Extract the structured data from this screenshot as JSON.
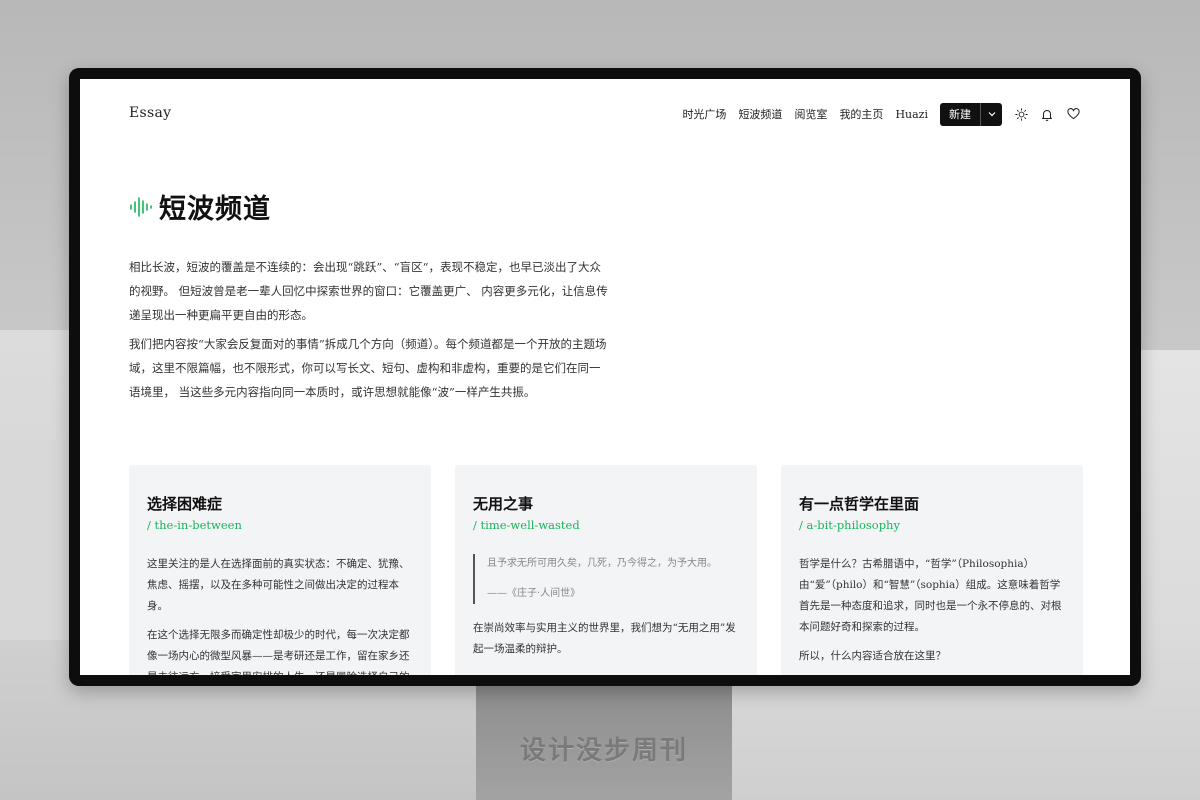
{
  "app": {
    "logo": "Essay",
    "nav": [
      "时光广场",
      "短波频道",
      "阅览室",
      "我的主页",
      "Huazi"
    ],
    "new_button": "新建",
    "icons": [
      "chevron-down-icon",
      "sun-icon",
      "bell-icon",
      "heart-icon"
    ]
  },
  "page": {
    "title": "短波频道",
    "title_icon": "sound-wave-icon",
    "accent_color": "#19b35a",
    "intro": [
      "相比长波，短波的覆盖是不连续的：会出现“跳跃”、“盲区“，表现不稳定，也早已淡出了大众的视野。 但短波曾是老一辈人回忆中探索世界的窗口：它覆盖更广、 内容更多元化，让信息传递呈现出一种更扁平更自由的形态。",
      "我们把内容按“大家会反复面对的事情”拆成几个方向（频道）。每个频道都是一个开放的主题场域，这里不限篇幅，也不限形式，你可以写长文、短句、虚构和非虚构，重要的是它们在同一语境里， 当这些多元内容指向同一本质时，或许思想就能像“波”一样产生共振。"
    ]
  },
  "cards": [
    {
      "title": "选择困难症",
      "slug": "/ the-in-between",
      "paragraphs": [
        "这里关注的是人在选择面前的真实状态：不确定、犹豫、焦虑、摇摆，以及在多种可能性之间做出决定的过程本身。",
        "在这个选择无限多而确定性却极少的时代，每一次决定都像一场内心的微型风暴——是考研还是工作，留在家乡还是去往远方，接受家里安排的人生，还是冒险选择自己的路。"
      ]
    },
    {
      "title": "无用之事",
      "slug": "/ time-well-wasted",
      "quote": "且予求无所可用久矣，几死，乃今得之，为予大用。",
      "quote_source": "——《庄子·人间世》",
      "paragraphs": [
        "在崇尚效率与实用主义的世界里，我们想为“无用之用”发起一场温柔的辩护。"
      ]
    },
    {
      "title": "有一点哲学在里面",
      "slug": "/ a-bit-philosophy",
      "paragraphs": [
        "哲学是什么？古希腊语中，“哲学”（Philosophia）由“爱”（philo）和“智慧”（sophia）组成。这意味着哲学首先是一种态度和追求，同时也是一个永不停息的、对根本问题好奇和探索的过程。",
        "所以，什么内容适合放在这里？"
      ]
    }
  ],
  "scene": {
    "stand_text": "设计没步周刊"
  }
}
